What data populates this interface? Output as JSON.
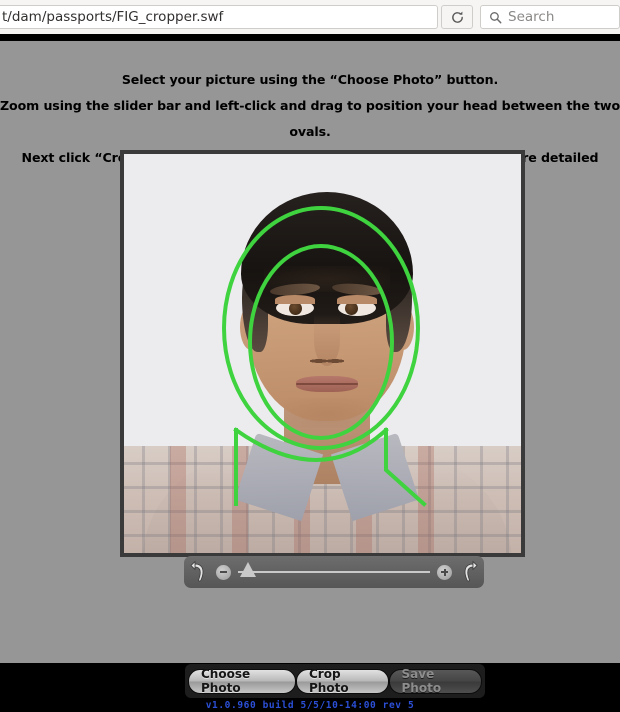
{
  "browser": {
    "url": "t/dam/passports/FIG_cropper.swf",
    "reload_icon": "reload-icon",
    "search_icon": "search-icon",
    "search_placeholder": "Search",
    "search_value": ""
  },
  "app": {
    "instructions": [
      "Select your picture using the “Choose Photo” button.",
      "Zoom using the slider bar and left-click and drag to position your head between the two ovals.",
      "Next click “Crop Photo” and then “Save Photo”.  Click on “Help” for more detailed instructions."
    ],
    "guide_color": "#3fd33f",
    "photo_border_color": "#3a3a3a",
    "page_background": "#969696",
    "controls": {
      "rotate_left_icon": "rotate-left-icon",
      "rotate_right_icon": "rotate-right-icon",
      "zoom_out_icon": "zoom-out-icon",
      "zoom_in_icon": "zoom-in-icon",
      "slider_value": 2,
      "slider_min": 0,
      "slider_max": 100
    },
    "buttons": [
      {
        "label": "Choose Photo",
        "state": "enabled"
      },
      {
        "label": "Crop Photo",
        "state": "enabled"
      },
      {
        "label": "Save Photo",
        "state": "disabled"
      }
    ],
    "version": "v1.0.960 build 5/5/10-14:00 rev 5",
    "version_color": "#2b4fd6"
  }
}
